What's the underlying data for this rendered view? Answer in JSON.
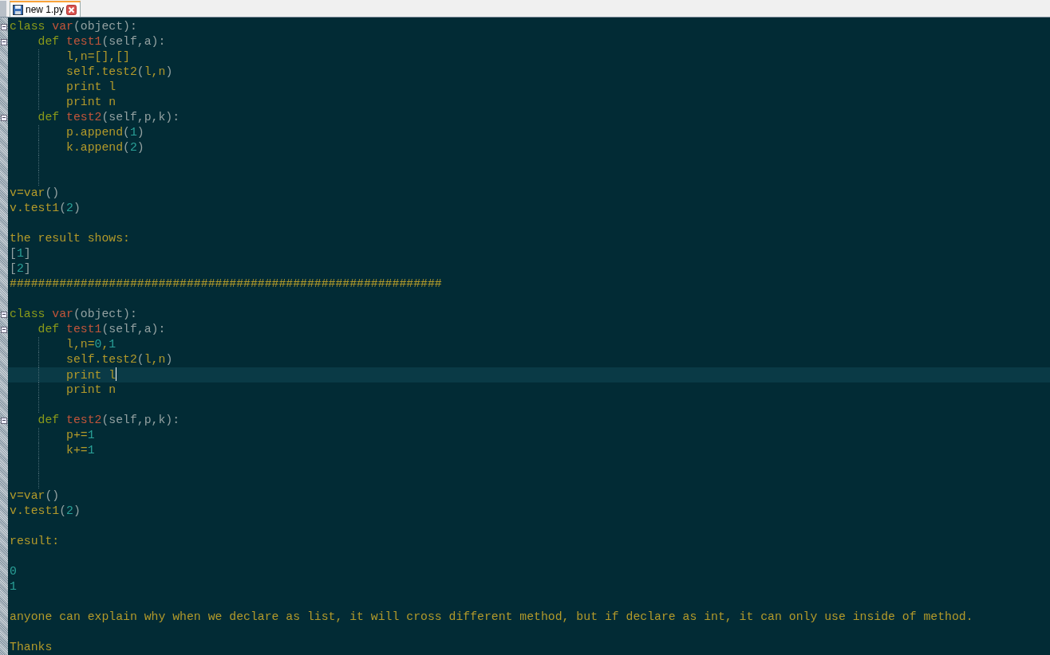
{
  "tab": {
    "title": "new 1.py",
    "selected": true
  },
  "lines": [
    {
      "fold": true,
      "guide": false,
      "current": false,
      "tokens": [
        {
          "kind": "keyword",
          "text": "class "
        },
        {
          "kind": "name",
          "text": "var"
        },
        {
          "kind": "punct",
          "text": "(object):"
        }
      ]
    },
    {
      "fold": true,
      "guide": false,
      "current": false,
      "tokens": [
        {
          "kind": "keyword",
          "text": "    def "
        },
        {
          "kind": "name",
          "text": "test1"
        },
        {
          "kind": "punct",
          "text": "(self,a):"
        }
      ]
    },
    {
      "fold": false,
      "guide": true,
      "current": false,
      "tokens": [
        {
          "kind": "plain",
          "text": "        l,n=[],[]"
        }
      ]
    },
    {
      "fold": false,
      "guide": true,
      "current": false,
      "tokens": [
        {
          "kind": "plain",
          "text": "        self.test2"
        },
        {
          "kind": "punct",
          "text": "("
        },
        {
          "kind": "plain",
          "text": "l,n"
        },
        {
          "kind": "punct",
          "text": ")"
        }
      ]
    },
    {
      "fold": false,
      "guide": true,
      "current": false,
      "tokens": [
        {
          "kind": "plain",
          "text": "        print l"
        }
      ]
    },
    {
      "fold": false,
      "guide": true,
      "current": false,
      "tokens": [
        {
          "kind": "plain",
          "text": "        print n"
        }
      ]
    },
    {
      "fold": true,
      "guide": false,
      "current": false,
      "tokens": [
        {
          "kind": "keyword",
          "text": "    def "
        },
        {
          "kind": "name",
          "text": "test2"
        },
        {
          "kind": "punct",
          "text": "(self,p,k):"
        }
      ]
    },
    {
      "fold": false,
      "guide": true,
      "current": false,
      "tokens": [
        {
          "kind": "plain",
          "text": "        p.append"
        },
        {
          "kind": "punct",
          "text": "("
        },
        {
          "kind": "number",
          "text": "1"
        },
        {
          "kind": "punct",
          "text": ")"
        }
      ]
    },
    {
      "fold": false,
      "guide": true,
      "current": false,
      "tokens": [
        {
          "kind": "plain",
          "text": "        k.append"
        },
        {
          "kind": "punct",
          "text": "("
        },
        {
          "kind": "number",
          "text": "2"
        },
        {
          "kind": "punct",
          "text": ")"
        }
      ]
    },
    {
      "fold": false,
      "guide": true,
      "current": false
    },
    {
      "fold": false,
      "guide": true,
      "current": false
    },
    {
      "fold": false,
      "guide": false,
      "current": false,
      "tokens": [
        {
          "kind": "plain",
          "text": "v=var"
        },
        {
          "kind": "punct",
          "text": "()"
        }
      ]
    },
    {
      "fold": false,
      "guide": false,
      "current": false,
      "tokens": [
        {
          "kind": "plain",
          "text": "v.test1"
        },
        {
          "kind": "punct",
          "text": "("
        },
        {
          "kind": "number",
          "text": "2"
        },
        {
          "kind": "punct",
          "text": ")"
        }
      ]
    },
    {
      "fold": false,
      "guide": false,
      "current": false
    },
    {
      "fold": false,
      "guide": false,
      "current": false,
      "tokens": [
        {
          "kind": "plain",
          "text": "the result shows:"
        }
      ]
    },
    {
      "fold": false,
      "guide": false,
      "current": false,
      "tokens": [
        {
          "kind": "punct",
          "text": "["
        },
        {
          "kind": "number",
          "text": "1"
        },
        {
          "kind": "punct",
          "text": "]"
        }
      ]
    },
    {
      "fold": false,
      "guide": false,
      "current": false,
      "tokens": [
        {
          "kind": "punct",
          "text": "["
        },
        {
          "kind": "number",
          "text": "2"
        },
        {
          "kind": "punct",
          "text": "]"
        }
      ]
    },
    {
      "fold": false,
      "guide": false,
      "current": false,
      "tokens": [
        {
          "kind": "plain",
          "text": "#############################################################"
        }
      ]
    },
    {
      "fold": false,
      "guide": false,
      "current": false
    },
    {
      "fold": true,
      "guide": false,
      "current": false,
      "tokens": [
        {
          "kind": "keyword",
          "text": "class "
        },
        {
          "kind": "name",
          "text": "var"
        },
        {
          "kind": "punct",
          "text": "(object):"
        }
      ]
    },
    {
      "fold": true,
      "guide": false,
      "current": false,
      "tokens": [
        {
          "kind": "keyword",
          "text": "    def "
        },
        {
          "kind": "name",
          "text": "test1"
        },
        {
          "kind": "punct",
          "text": "(self,a):"
        }
      ]
    },
    {
      "fold": false,
      "guide": true,
      "current": false,
      "tokens": [
        {
          "kind": "plain",
          "text": "        l,n="
        },
        {
          "kind": "number",
          "text": "0"
        },
        {
          "kind": "plain",
          "text": ","
        },
        {
          "kind": "number",
          "text": "1"
        }
      ]
    },
    {
      "fold": false,
      "guide": true,
      "current": false,
      "tokens": [
        {
          "kind": "plain",
          "text": "        self.test2"
        },
        {
          "kind": "punct",
          "text": "("
        },
        {
          "kind": "plain",
          "text": "l,n"
        },
        {
          "kind": "punct",
          "text": ")"
        }
      ]
    },
    {
      "fold": false,
      "guide": true,
      "current": true,
      "tokens": [
        {
          "kind": "plain",
          "text": "        print l"
        }
      ]
    },
    {
      "fold": false,
      "guide": true,
      "current": false,
      "tokens": [
        {
          "kind": "plain",
          "text": "        print n"
        }
      ]
    },
    {
      "fold": false,
      "guide": true,
      "current": false
    },
    {
      "fold": true,
      "guide": false,
      "current": false,
      "tokens": [
        {
          "kind": "keyword",
          "text": "    def "
        },
        {
          "kind": "name",
          "text": "test2"
        },
        {
          "kind": "punct",
          "text": "(self,p,k):"
        }
      ]
    },
    {
      "fold": false,
      "guide": true,
      "current": false,
      "tokens": [
        {
          "kind": "plain",
          "text": "        p+="
        },
        {
          "kind": "number",
          "text": "1"
        }
      ]
    },
    {
      "fold": false,
      "guide": true,
      "current": false,
      "tokens": [
        {
          "kind": "plain",
          "text": "        k+="
        },
        {
          "kind": "number",
          "text": "1"
        }
      ]
    },
    {
      "fold": false,
      "guide": true,
      "current": false
    },
    {
      "fold": false,
      "guide": true,
      "current": false
    },
    {
      "fold": false,
      "guide": false,
      "current": false,
      "tokens": [
        {
          "kind": "plain",
          "text": "v=var"
        },
        {
          "kind": "punct",
          "text": "()"
        }
      ]
    },
    {
      "fold": false,
      "guide": false,
      "current": false,
      "tokens": [
        {
          "kind": "plain",
          "text": "v.test1"
        },
        {
          "kind": "punct",
          "text": "("
        },
        {
          "kind": "number",
          "text": "2"
        },
        {
          "kind": "punct",
          "text": ")"
        }
      ]
    },
    {
      "fold": false,
      "guide": false,
      "current": false
    },
    {
      "fold": false,
      "guide": false,
      "current": false,
      "tokens": [
        {
          "kind": "plain",
          "text": "result:"
        }
      ]
    },
    {
      "fold": false,
      "guide": false,
      "current": false
    },
    {
      "fold": false,
      "guide": false,
      "current": false,
      "tokens": [
        {
          "kind": "number",
          "text": "0"
        }
      ]
    },
    {
      "fold": false,
      "guide": false,
      "current": false,
      "tokens": [
        {
          "kind": "number",
          "text": "1"
        }
      ]
    },
    {
      "fold": false,
      "guide": false,
      "current": false
    },
    {
      "fold": false,
      "guide": false,
      "current": false,
      "tokens": [
        {
          "kind": "plain",
          "text": "anyone can explain why when we declare as list, it will cross different method, but if declare as int, it can only use inside of method."
        }
      ]
    },
    {
      "fold": false,
      "guide": false,
      "current": false
    },
    {
      "fold": false,
      "guide": false,
      "current": false,
      "tokens": [
        {
          "kind": "plain",
          "text": "Thanks"
        }
      ]
    }
  ]
}
